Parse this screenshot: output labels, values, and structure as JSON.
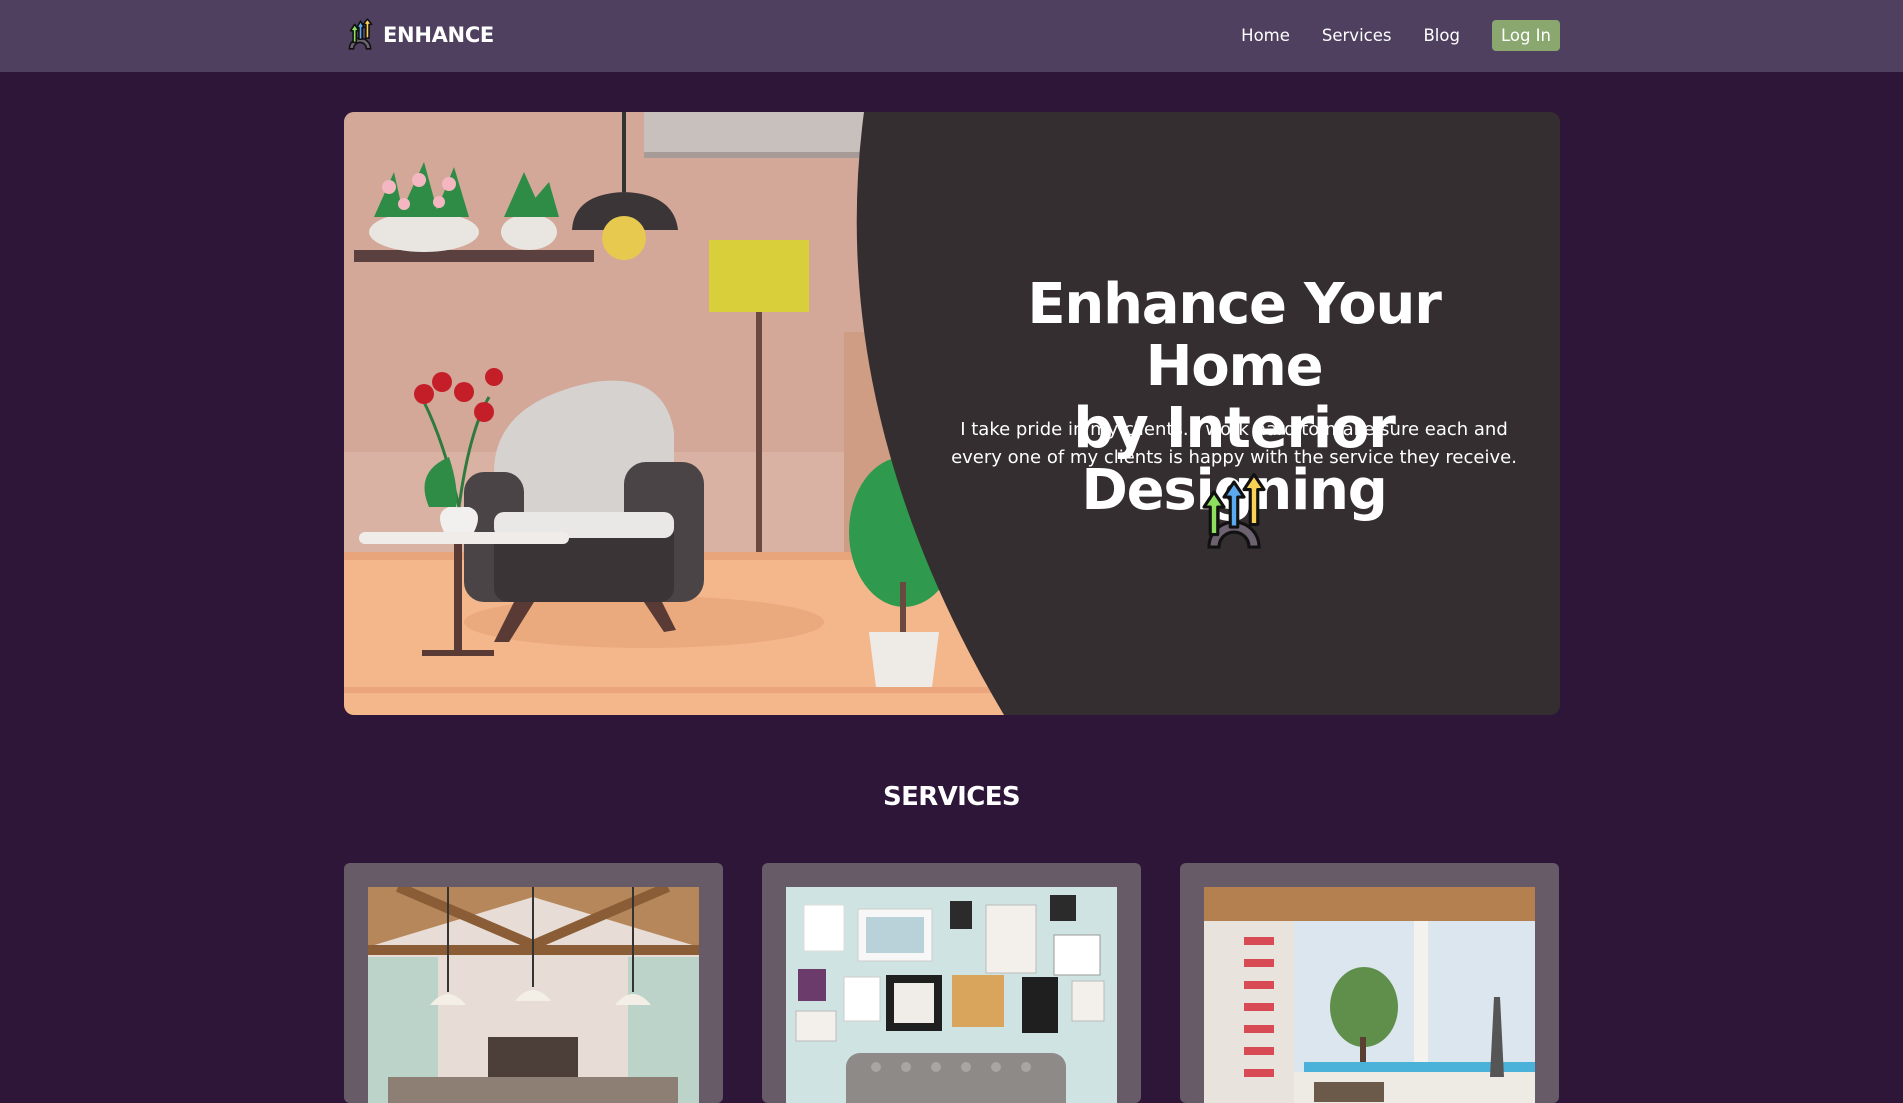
{
  "navbar": {
    "brand": "ENHANCE",
    "links": [
      "Home",
      "Services",
      "Blog"
    ],
    "login_label": "Log In"
  },
  "hero": {
    "title_line1": "Enhance Your Home",
    "title_line2": "by Interior Designing",
    "description": "I take pride in my clients. I work hard to make sure each and every one of my clients is happy with the service they receive."
  },
  "services": {
    "heading": "SERVICES",
    "cards": [
      {
        "image": "vaulted-ceiling-living-room-photo"
      },
      {
        "image": "gallery-wall-sofa-photo"
      },
      {
        "image": "modern-patio-red-stair-photo"
      }
    ]
  },
  "colors": {
    "background": "#2e1639",
    "navbar": "#4f4060",
    "login_button": "#8aa770",
    "hero_panel": "#342e30",
    "card": "#685b68"
  },
  "icons": [
    "brand-logo-icon",
    "arrows-gear-icon"
  ]
}
